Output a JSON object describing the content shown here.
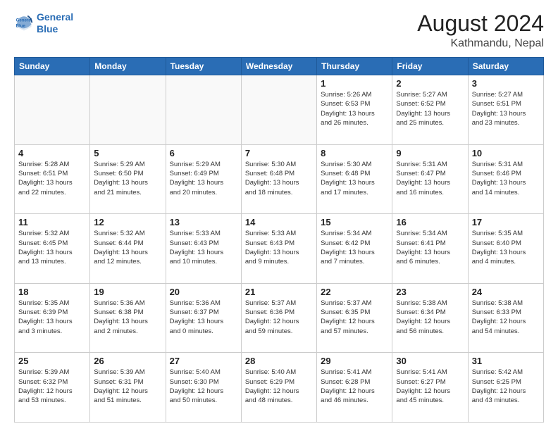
{
  "logo": {
    "line1": "General",
    "line2": "Blue"
  },
  "title": "August 2024",
  "subtitle": "Kathmandu, Nepal",
  "days_header": [
    "Sunday",
    "Monday",
    "Tuesday",
    "Wednesday",
    "Thursday",
    "Friday",
    "Saturday"
  ],
  "weeks": [
    [
      {
        "day": "",
        "info": "",
        "empty": true
      },
      {
        "day": "",
        "info": "",
        "empty": true
      },
      {
        "day": "",
        "info": "",
        "empty": true
      },
      {
        "day": "",
        "info": "",
        "empty": true
      },
      {
        "day": "1",
        "info": "Sunrise: 5:26 AM\nSunset: 6:53 PM\nDaylight: 13 hours\nand 26 minutes."
      },
      {
        "day": "2",
        "info": "Sunrise: 5:27 AM\nSunset: 6:52 PM\nDaylight: 13 hours\nand 25 minutes."
      },
      {
        "day": "3",
        "info": "Sunrise: 5:27 AM\nSunset: 6:51 PM\nDaylight: 13 hours\nand 23 minutes."
      }
    ],
    [
      {
        "day": "4",
        "info": "Sunrise: 5:28 AM\nSunset: 6:51 PM\nDaylight: 13 hours\nand 22 minutes."
      },
      {
        "day": "5",
        "info": "Sunrise: 5:29 AM\nSunset: 6:50 PM\nDaylight: 13 hours\nand 21 minutes."
      },
      {
        "day": "6",
        "info": "Sunrise: 5:29 AM\nSunset: 6:49 PM\nDaylight: 13 hours\nand 20 minutes."
      },
      {
        "day": "7",
        "info": "Sunrise: 5:30 AM\nSunset: 6:48 PM\nDaylight: 13 hours\nand 18 minutes."
      },
      {
        "day": "8",
        "info": "Sunrise: 5:30 AM\nSunset: 6:48 PM\nDaylight: 13 hours\nand 17 minutes."
      },
      {
        "day": "9",
        "info": "Sunrise: 5:31 AM\nSunset: 6:47 PM\nDaylight: 13 hours\nand 16 minutes."
      },
      {
        "day": "10",
        "info": "Sunrise: 5:31 AM\nSunset: 6:46 PM\nDaylight: 13 hours\nand 14 minutes."
      }
    ],
    [
      {
        "day": "11",
        "info": "Sunrise: 5:32 AM\nSunset: 6:45 PM\nDaylight: 13 hours\nand 13 minutes."
      },
      {
        "day": "12",
        "info": "Sunrise: 5:32 AM\nSunset: 6:44 PM\nDaylight: 13 hours\nand 12 minutes."
      },
      {
        "day": "13",
        "info": "Sunrise: 5:33 AM\nSunset: 6:43 PM\nDaylight: 13 hours\nand 10 minutes."
      },
      {
        "day": "14",
        "info": "Sunrise: 5:33 AM\nSunset: 6:43 PM\nDaylight: 13 hours\nand 9 minutes."
      },
      {
        "day": "15",
        "info": "Sunrise: 5:34 AM\nSunset: 6:42 PM\nDaylight: 13 hours\nand 7 minutes."
      },
      {
        "day": "16",
        "info": "Sunrise: 5:34 AM\nSunset: 6:41 PM\nDaylight: 13 hours\nand 6 minutes."
      },
      {
        "day": "17",
        "info": "Sunrise: 5:35 AM\nSunset: 6:40 PM\nDaylight: 13 hours\nand 4 minutes."
      }
    ],
    [
      {
        "day": "18",
        "info": "Sunrise: 5:35 AM\nSunset: 6:39 PM\nDaylight: 13 hours\nand 3 minutes."
      },
      {
        "day": "19",
        "info": "Sunrise: 5:36 AM\nSunset: 6:38 PM\nDaylight: 13 hours\nand 2 minutes."
      },
      {
        "day": "20",
        "info": "Sunrise: 5:36 AM\nSunset: 6:37 PM\nDaylight: 13 hours\nand 0 minutes."
      },
      {
        "day": "21",
        "info": "Sunrise: 5:37 AM\nSunset: 6:36 PM\nDaylight: 12 hours\nand 59 minutes."
      },
      {
        "day": "22",
        "info": "Sunrise: 5:37 AM\nSunset: 6:35 PM\nDaylight: 12 hours\nand 57 minutes."
      },
      {
        "day": "23",
        "info": "Sunrise: 5:38 AM\nSunset: 6:34 PM\nDaylight: 12 hours\nand 56 minutes."
      },
      {
        "day": "24",
        "info": "Sunrise: 5:38 AM\nSunset: 6:33 PM\nDaylight: 12 hours\nand 54 minutes."
      }
    ],
    [
      {
        "day": "25",
        "info": "Sunrise: 5:39 AM\nSunset: 6:32 PM\nDaylight: 12 hours\nand 53 minutes."
      },
      {
        "day": "26",
        "info": "Sunrise: 5:39 AM\nSunset: 6:31 PM\nDaylight: 12 hours\nand 51 minutes."
      },
      {
        "day": "27",
        "info": "Sunrise: 5:40 AM\nSunset: 6:30 PM\nDaylight: 12 hours\nand 50 minutes."
      },
      {
        "day": "28",
        "info": "Sunrise: 5:40 AM\nSunset: 6:29 PM\nDaylight: 12 hours\nand 48 minutes."
      },
      {
        "day": "29",
        "info": "Sunrise: 5:41 AM\nSunset: 6:28 PM\nDaylight: 12 hours\nand 46 minutes."
      },
      {
        "day": "30",
        "info": "Sunrise: 5:41 AM\nSunset: 6:27 PM\nDaylight: 12 hours\nand 45 minutes."
      },
      {
        "day": "31",
        "info": "Sunrise: 5:42 AM\nSunset: 6:25 PM\nDaylight: 12 hours\nand 43 minutes."
      }
    ]
  ]
}
